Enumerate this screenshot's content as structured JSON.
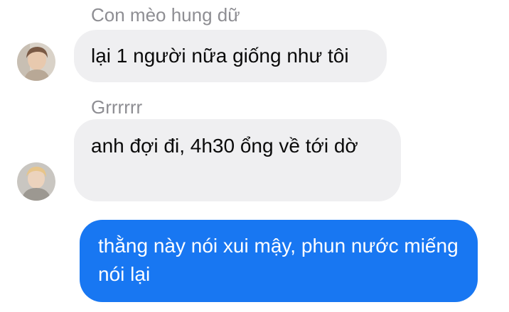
{
  "colors": {
    "incoming_bubble": "#efeff1",
    "outgoing_bubble": "#1877f2",
    "sender_name": "#8e8e93"
  },
  "messages": [
    {
      "sender": "Con mèo hung dữ",
      "direction": "incoming",
      "text": "lại 1 người nữa giống như tôi",
      "avatar": "user-avatar-photo"
    },
    {
      "sender": "Grrrrrr",
      "direction": "incoming",
      "text": "anh đợi đi, 4h30 ổng về tới dờ",
      "avatar": "user-avatar-photo"
    },
    {
      "direction": "outgoing",
      "text": "thằng này nói xui mậy, phun nước miếng nói lại"
    }
  ]
}
